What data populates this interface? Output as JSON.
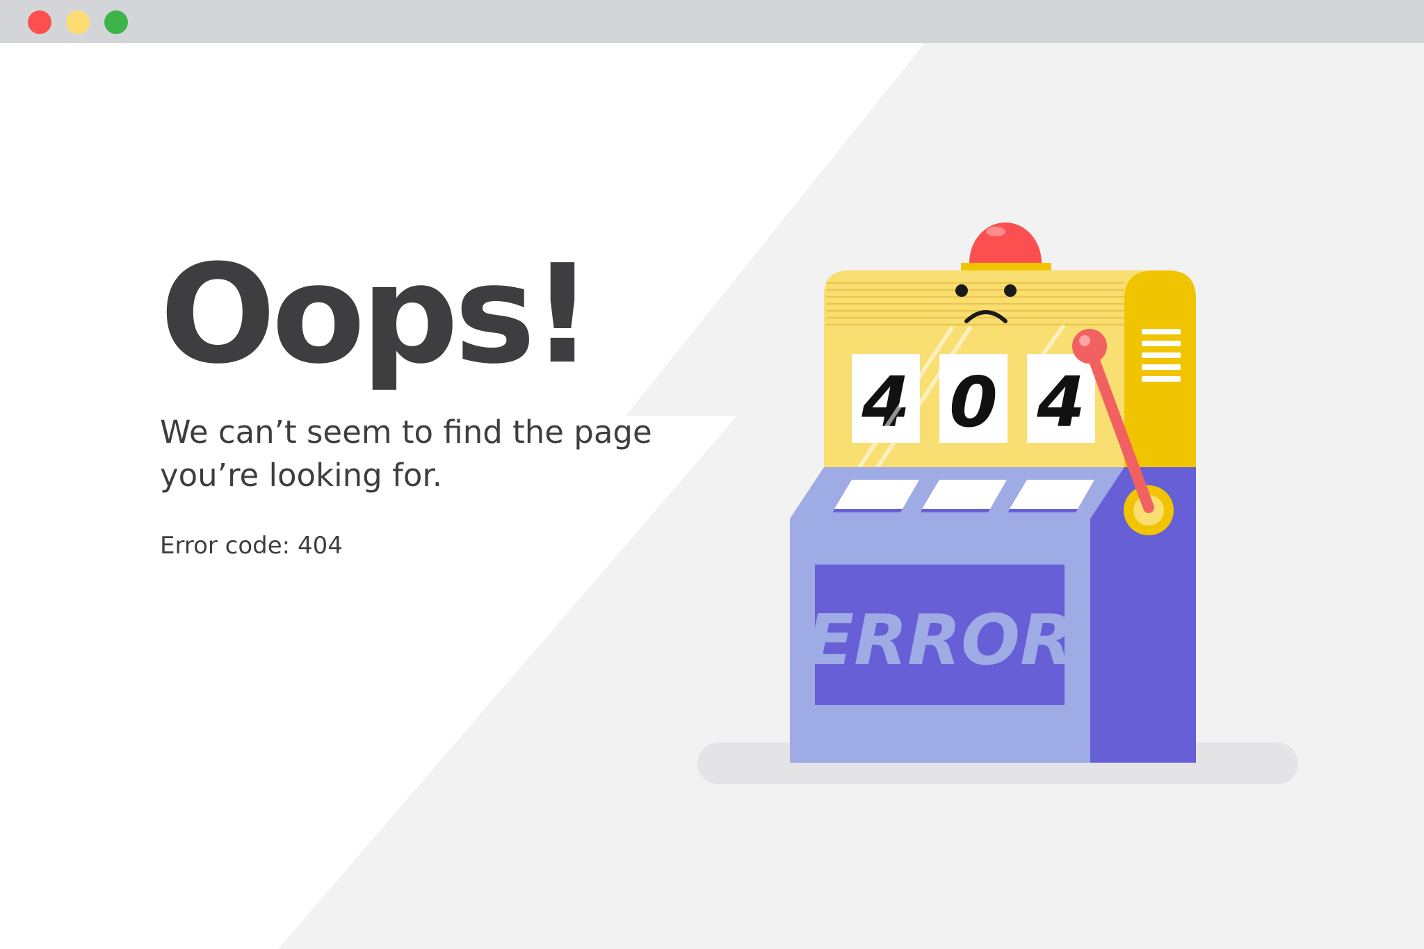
{
  "window": {
    "controls": [
      {
        "name": "close",
        "color": "#fc4f4f"
      },
      {
        "name": "minimize",
        "color": "#fddc72"
      },
      {
        "name": "maximize",
        "color": "#3db34a"
      }
    ]
  },
  "error_page": {
    "heading": "Oops!",
    "message": "We can’t seem to find the page you’re looking for.",
    "error_code_text": "Error code: 404"
  },
  "illustration": {
    "reels": [
      "4",
      "0",
      "4"
    ],
    "panel_label": "ERROR",
    "colors": {
      "head_yellow": "#f9de72",
      "head_dark_yellow": "#f0c400",
      "body_light": "#9eabe4",
      "body_dark": "#675fd6",
      "alarm_red": "#fc4f4f",
      "lever_red": "#f26161"
    }
  }
}
